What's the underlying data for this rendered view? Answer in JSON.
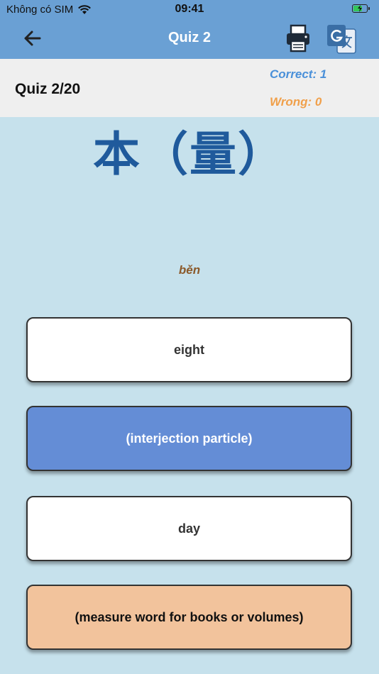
{
  "status_bar": {
    "carrier": "Không có SIM",
    "time": "09:41"
  },
  "nav": {
    "title": "Quiz 2",
    "back_icon": "arrow-left-icon",
    "print_icon": "printer-icon",
    "translate_icon": "google-translate-icon"
  },
  "quiz": {
    "progress": "Quiz 2/20",
    "correct": "Correct: 1",
    "wrong": "Wrong: 0"
  },
  "question": {
    "character": "本（量）",
    "pinyin": "běn"
  },
  "options": [
    {
      "label": "eight",
      "state": "default"
    },
    {
      "label": "(interjection particle)",
      "state": "selected"
    },
    {
      "label": "day",
      "state": "default"
    },
    {
      "label": "(measure word for books or volumes)",
      "state": "highlighted"
    }
  ],
  "colors": {
    "nav_bar": "#6aa0d4",
    "background": "#c6e1ec",
    "header": "#efefef",
    "correct": "#4a90d9",
    "wrong": "#f0a04b",
    "character": "#1f5a9c",
    "selected_option": "#648dd6",
    "highlighted_option": "#f2c39c"
  }
}
